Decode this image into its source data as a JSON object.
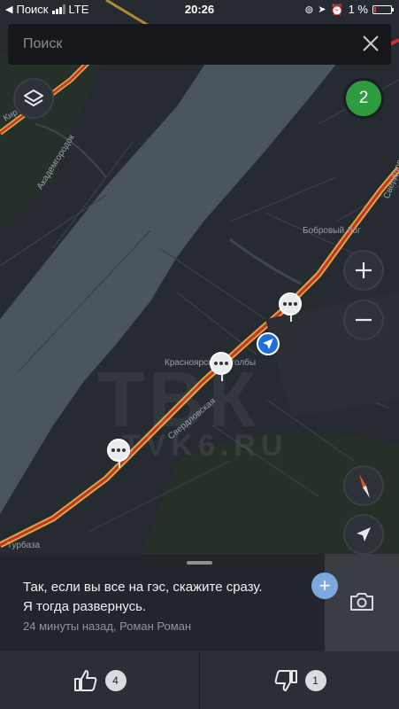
{
  "status_bar": {
    "carrier": "Поиск",
    "network": "LTE",
    "time": "20:26",
    "battery": "1 %"
  },
  "search": {
    "placeholder": "Поиск"
  },
  "map": {
    "report_count_badge": "2",
    "labels": {
      "akademgorodok": "Академгородок",
      "bobrovy_log": "Бобровый Лог",
      "krasnoyarskie_stolby": "Красноярские Столбы",
      "sverdlovskaya": "Свердловская",
      "sverdlovskaya_top": "Свердловская",
      "turbaza": "Турбаза",
      "kirov": "Кир"
    },
    "watermark": {
      "logo": "ТВК",
      "site": "TVK6.RU"
    },
    "icons": {
      "layers": "layers-icon",
      "zoom_in": "plus-icon",
      "zoom_out": "minus-icon",
      "compass": "compass-icon",
      "locate": "navigation-arrow-icon"
    },
    "colors": {
      "traffic_red": "#c9302c",
      "traffic_yellow": "#d6a93a",
      "water": "#4a5560",
      "badge_green": "#2f9b3f",
      "position_blue": "#1e6fd9"
    }
  },
  "sheet": {
    "comment_line1": "Так, если вы все на гэс, скажите сразу.",
    "comment_line2": "Я тогда развернусь.",
    "meta": "24 минуты назад, Роман Роман",
    "add_label": "+"
  },
  "votes": {
    "likes": "4",
    "dislikes": "1"
  }
}
